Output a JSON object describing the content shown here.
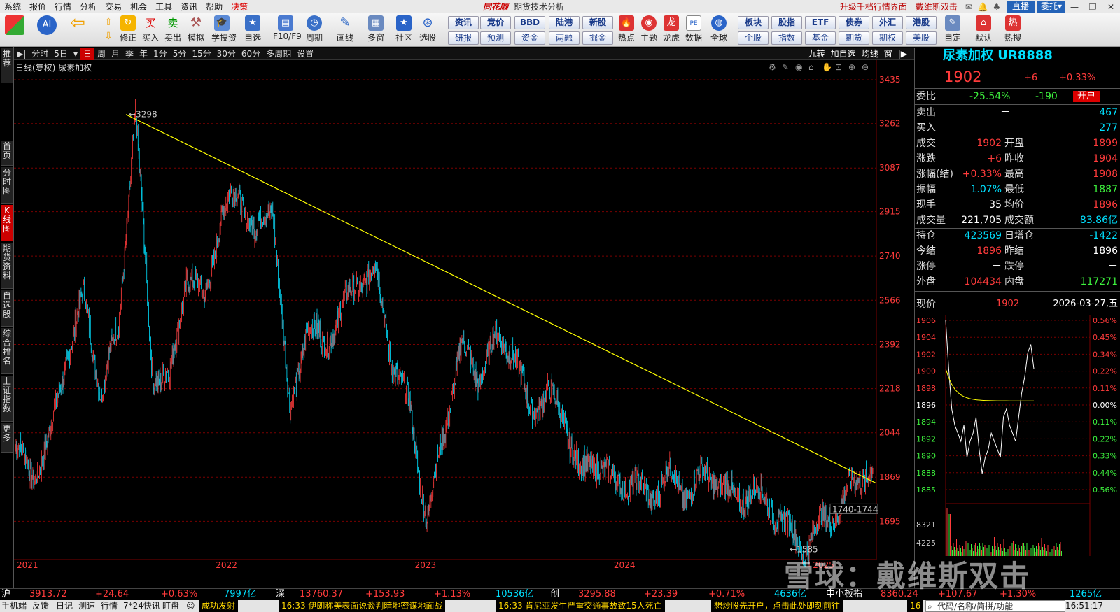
{
  "menu": [
    "系统",
    "报价",
    "行情",
    "分析",
    "交易",
    "机会",
    "工具",
    "资讯",
    "帮助",
    "决策"
  ],
  "title": {
    "logo": "同花顺",
    "subtitle": "期货技术分析"
  },
  "topright": {
    "upgrade": "升级千档行情界面",
    "user": "戴维斯双击",
    "zhibo": "直播",
    "weituo": "委托",
    "weituo_arrow": "▾"
  },
  "toolbar": {
    "icons": [
      {
        "label": "",
        "icon": "ths-logo-icon"
      },
      {
        "label": "",
        "icon": "ai-icon"
      },
      {
        "label": "",
        "icon": "back-arrow-icon"
      },
      {
        "label": "修正",
        "icon": "fix-icon"
      },
      {
        "label": "买入",
        "icon": "buy-icon"
      },
      {
        "label": "卖出",
        "icon": "sell-icon"
      },
      {
        "label": "模拟",
        "icon": "hammer-icon"
      },
      {
        "label": "学投资",
        "icon": "learn-icon"
      },
      {
        "label": "自选",
        "icon": "star-icon"
      },
      {
        "label": "F10/F9",
        "icon": "f10-icon"
      },
      {
        "label": "周期",
        "icon": "clock-icon"
      },
      {
        "label": "画线",
        "icon": "pen-icon"
      },
      {
        "label": "多窗",
        "icon": "windows-icon"
      },
      {
        "label": "社区",
        "icon": "community-icon"
      },
      {
        "label": "选股",
        "icon": "select-icon"
      }
    ],
    "btn_grid": [
      [
        "资讯",
        "竞价",
        "BBD",
        "陆港",
        "新股"
      ],
      [
        "研报",
        "预测",
        "资金",
        "两融",
        "掘金"
      ]
    ],
    "icons2": [
      {
        "label": "热点",
        "icon": "hot-icon"
      },
      {
        "label": "主题",
        "icon": "theme-icon"
      },
      {
        "label": "龙虎",
        "icon": "dragon-icon"
      },
      {
        "label": "数据",
        "icon": "data-icon"
      },
      {
        "label": "全球",
        "icon": "globe-icon"
      }
    ],
    "btn_grid2": [
      [
        "板块",
        "股指",
        "ETF",
        "债券",
        "外汇",
        "港股"
      ],
      [
        "个股",
        "指数",
        "基金",
        "期货",
        "期权",
        "美股"
      ]
    ],
    "icons3": [
      {
        "label": "自定",
        "icon": "custom-icon"
      },
      {
        "label": "默认",
        "icon": "home-icon"
      },
      {
        "label": "热搜",
        "icon": "hotsearch-icon"
      }
    ]
  },
  "leftnav": [
    "推荐",
    "首页",
    "分时图",
    "K线图",
    "期货资料",
    "自选股",
    "综合排名",
    "上证指数",
    "更多"
  ],
  "chart_tabs": [
    "分时",
    "5日",
    "日",
    "周",
    "月",
    "季",
    "年",
    "1分",
    "5分",
    "15分",
    "30分",
    "60分",
    "多周期",
    "设置"
  ],
  "chart_tabs_right": [
    "九转",
    "加自选",
    "均线",
    "窗"
  ],
  "chart_subtitle": "日线(复权) 尿素加权",
  "quote": {
    "name": "尿素加权",
    "code": "UR8888",
    "price": "1902",
    "change": "+6",
    "pct": "+0.33%",
    "rows": [
      {
        "label": "委比",
        "v1": "-25.54%",
        "v2": "-190",
        "tag": "开户"
      },
      {
        "label": "卖出",
        "v1": "－",
        "v2": "467"
      },
      {
        "label": "买入",
        "v1": "－",
        "v2": "277"
      }
    ],
    "grid": [
      {
        "l1": "成交",
        "v1": "1902",
        "l2": "开盘",
        "v2": "1899"
      },
      {
        "l1": "涨跌",
        "v1": "+6",
        "l2": "昨收",
        "v2": "1904"
      },
      {
        "l1": "涨幅(结)",
        "v1": "+0.33%",
        "l2": "最高",
        "v2": "1908"
      },
      {
        "l1": "振幅",
        "v1": "1.07%",
        "l2": "最低",
        "v2": "1887"
      },
      {
        "l1": "现手",
        "v1": "35",
        "l2": "均价",
        "v2": "1896"
      },
      {
        "l1": "成交量",
        "v1": "221,705",
        "l2": "成交额",
        "v2": "83.86亿"
      }
    ],
    "grid2": [
      {
        "l1": "持仓",
        "v1": "423569",
        "l2": "日增仓",
        "v2": "-1422"
      },
      {
        "l1": "今结",
        "v1": "1896",
        "l2": "昨结",
        "v2": "1896"
      },
      {
        "l1": "涨停",
        "v1": "－",
        "l2": "跌停",
        "v2": "－"
      },
      {
        "l1": "外盘",
        "v1": "104434",
        "l2": "内盘",
        "v2": "117271"
      }
    ],
    "intraday_head": {
      "label": "现价",
      "price": "1902",
      "date": "2026-03-27,五"
    }
  },
  "colors": {
    "up": "#ff3b3b",
    "down": "#00e0ff",
    "trend": "#ffff00",
    "grid": "#7a0000"
  },
  "chart_data": [
    {
      "type": "candlestick",
      "title": "日线(复权) 尿素加权",
      "x_labels": [
        "2021",
        "2022",
        "2023",
        "2024",
        "2025"
      ],
      "y_ticks": [
        3435,
        3262,
        3087,
        2915,
        2740,
        2566,
        2392,
        2218,
        2044,
        1869,
        1695
      ],
      "ylim": [
        1550,
        3490
      ],
      "annotations": [
        "3298",
        "1585",
        "1740-1744"
      ],
      "trendline": {
        "from_value": 3298,
        "to_value": 1845
      },
      "series": [
        {
          "name": "",
          "close_path": [
            1990,
            1870,
            2020,
            2350,
            2580,
            2200,
            2460,
            3298,
            2280,
            2250,
            2680,
            2560,
            2900,
            3000,
            2820,
            2960,
            2100,
            2480,
            2380,
            2530,
            2640,
            2690,
            2320,
            2140,
            1700,
            2050,
            2390,
            2260,
            2410,
            2380,
            2120,
            2210,
            2090,
            1880,
            1945,
            1830,
            1860,
            1775,
            1890,
            1800,
            1875,
            1860,
            1770,
            1820,
            1760,
            1670,
            1585,
            1690,
            1745,
            1860,
            1905
          ]
        }
      ]
    },
    {
      "type": "line",
      "title": "intraday",
      "y_ticks": [
        1906,
        1904,
        1902,
        1900,
        1898,
        1896,
        1894,
        1892,
        1890,
        1888,
        1885
      ],
      "pct_ticks": [
        "0.56%",
        "0.45%",
        "0.34%",
        "0.22%",
        "0.11%",
        "0.00%",
        "0.11%",
        "0.22%",
        "0.33%",
        "0.44%",
        "0.56%"
      ],
      "vol_ticks": [
        "8321",
        "4225"
      ],
      "series": [
        {
          "name": "",
          "values": [
            1906,
            1900,
            1895,
            1893,
            1892,
            1891,
            1893,
            1889,
            1891,
            1892,
            1894,
            1890,
            1887,
            1889,
            1890,
            1892,
            1891,
            1890,
            1889,
            1894,
            1895,
            1893,
            1892,
            1891,
            1894,
            1897,
            1899,
            1902,
            1903,
            1900
          ]
        }
      ]
    }
  ],
  "bottom": {
    "sh_label": "沪",
    "sh": "3913.72",
    "sh_chg": "+24.64",
    "sh_pct": "+0.63%",
    "sh_amt": "7997亿",
    "sz_label": "深",
    "sz": "13760.37",
    "sz_chg": "+153.93",
    "sz_pct": "+1.13%",
    "sz_amt": "10536亿",
    "cy_label": "创",
    "cy": "3295.88",
    "cy_chg": "+23.39",
    "cy_pct": "+0.71%",
    "cy_amt": "4636亿",
    "zx_label": "中小板指",
    "zx": "8360.24",
    "zx_chg": "+107.67",
    "zx_pct": "+1.30%",
    "zx_amt": "1265亿"
  },
  "status": {
    "items": [
      "手机端",
      "反馈",
      "日记",
      "测速",
      "行情",
      "7*24快讯",
      "盯盘"
    ],
    "news": [
      "成功发射",
      "16:33 伊朗称美表面说谈判暗地密谋地面战",
      "16:33 肯尼亚发生严重交通事故致15人死亡",
      "想炒股先开户，点击此处即刻前往",
      "16"
    ],
    "code_placeholder": "代码/名称/简拼/功能",
    "time": "16:51:17"
  },
  "watermark": "雪球：戴维斯双击"
}
